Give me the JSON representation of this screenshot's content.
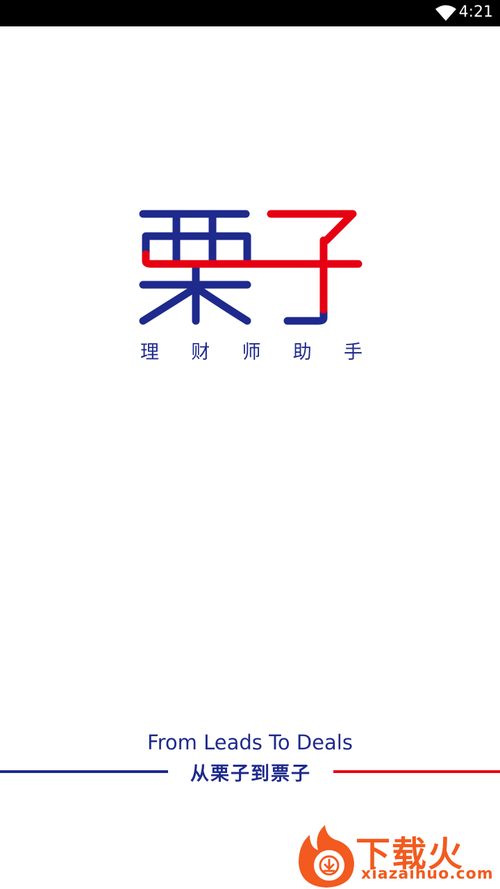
{
  "status_bar": {
    "time": "4:21",
    "wifi_icon": "wifi-icon"
  },
  "splash": {
    "logo_text": "栗子",
    "logo_colors": {
      "primary": "#1e2a8c",
      "accent": "#e60012"
    },
    "tagline_chars": [
      "理",
      "财",
      "师",
      "助",
      "手"
    ],
    "slogan_en": "From Leads To Deals",
    "slogan_cn": "从栗子到票子"
  },
  "watermark": {
    "icon": "flame-download-icon",
    "title": "下载火",
    "domain": "xiazaihuo.com",
    "color": "#f25a1f"
  }
}
